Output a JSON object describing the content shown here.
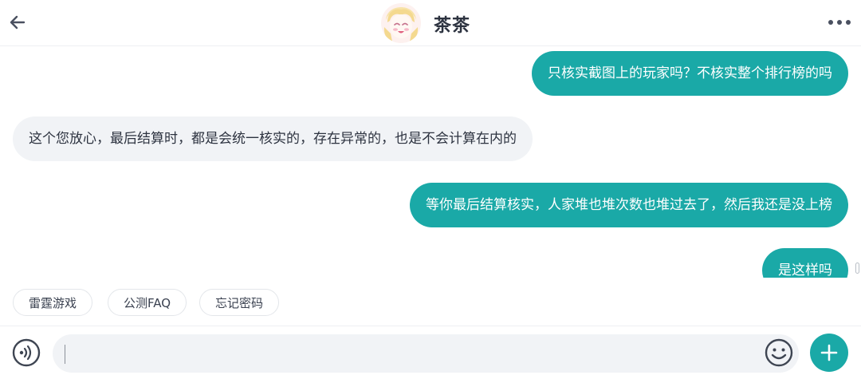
{
  "header": {
    "title": "茶茶",
    "back_icon": "arrow-left-icon",
    "more_icon": "more-horizontal-icon"
  },
  "messages": [
    {
      "from": "me",
      "text": "只核实截图上的玩家吗？不核实整个排行榜的吗"
    },
    {
      "from": "them",
      "text": "这个您放心，最后结算时，都是会统一核实的，存在异常的，也是不会计算在内的"
    },
    {
      "from": "me",
      "text": "等你最后结算核实，人家堆也堆次数也堆过去了，然后我还是没上榜"
    },
    {
      "from": "me",
      "text": "是这样吗"
    }
  ],
  "quick_replies": [
    "雷霆游戏",
    "公测FAQ",
    "忘记密码"
  ],
  "input": {
    "value": "",
    "voice_icon": "voice-input-icon",
    "emoji_icon": "emoji-icon",
    "plus_icon": "plus-icon"
  },
  "colors": {
    "accent": "#1aa9a7",
    "bubble_other": "#f1f3f6",
    "title_text": "#2d3340"
  }
}
